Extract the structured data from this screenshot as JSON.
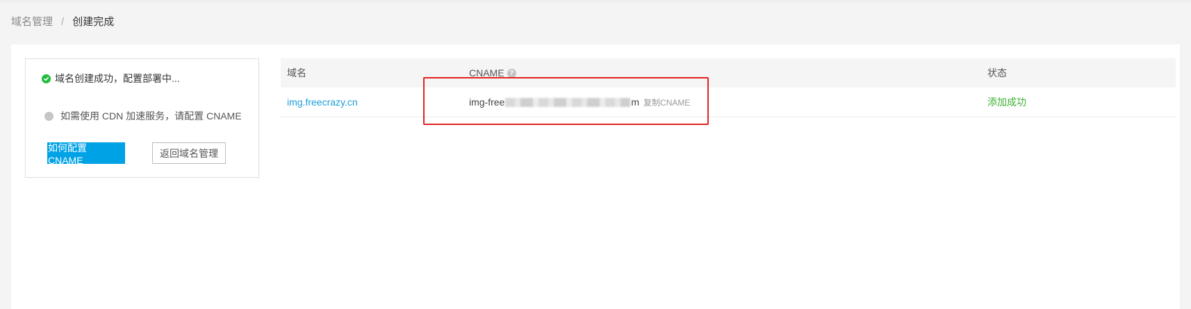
{
  "breadcrumb": {
    "parent": "域名管理",
    "separator": "/",
    "current": "创建完成"
  },
  "status_card": {
    "step1_text": "域名创建成功，配置部署中...",
    "step2_text": "如需使用 CDN 加速服务，请配置 CNAME",
    "primary_button": "如何配置 CNAME",
    "secondary_button": "返回域名管理"
  },
  "table": {
    "headers": {
      "domain": "域名",
      "cname": "CNAME",
      "status": "状态"
    },
    "help_icon_glyph": "?",
    "rows": [
      {
        "domain": "img.freecrazy.cn",
        "cname_prefix": "img-free",
        "cname_suffix": "m",
        "copy_label": "复制CNAME",
        "status": "添加成功"
      }
    ]
  },
  "colors": {
    "accent": "#00a2e6",
    "link": "#1a9fd9",
    "success": "#3cb034",
    "highlight": "#e52020"
  },
  "icons": {
    "step1": "check-circle-icon",
    "step2": "pending-dot-icon",
    "cname_help": "help-icon"
  }
}
